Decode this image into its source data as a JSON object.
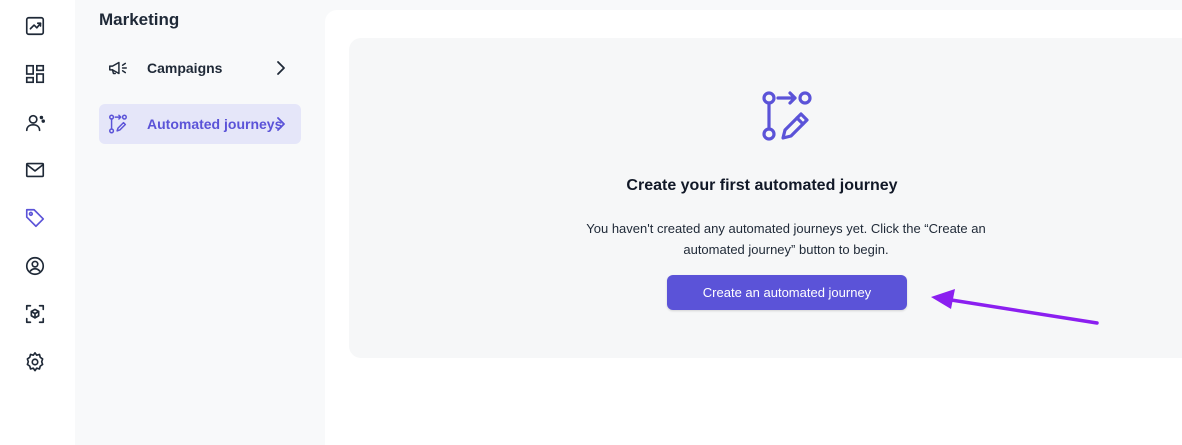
{
  "rail": {
    "icons": [
      "trend-chart-icon",
      "dashboard-grid-icon",
      "contacts-icon",
      "mail-icon",
      "tag-icon",
      "user-circle-icon",
      "cube-scan-icon",
      "settings-gear-icon"
    ],
    "active": "tag-icon"
  },
  "subnav": {
    "title": "Marketing",
    "items": [
      {
        "label": "Campaigns",
        "icon": "megaphone-icon",
        "active": false
      },
      {
        "label": "Automated journeys",
        "icon": "journey-flow-icon",
        "active": true
      }
    ]
  },
  "empty_state": {
    "icon": "journey-edit-icon",
    "title": "Create your first automated journey",
    "description": "You haven't created any automated journeys yet. Click the “Create an automated journey” button to begin.",
    "button_label": "Create an automated journey"
  },
  "colors": {
    "accent": "#5b53d8",
    "active_bg": "#e5e6f9",
    "annotation_arrow": "#8b1ff0"
  }
}
